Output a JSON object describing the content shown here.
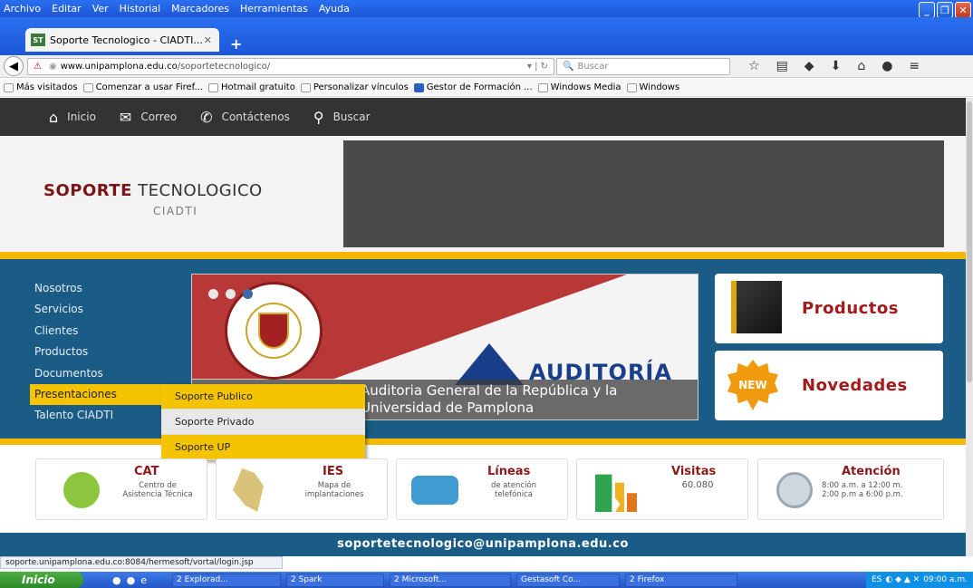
{
  "browser": {
    "menu": [
      "Archivo",
      "Editar",
      "Ver",
      "Historial",
      "Marcadores",
      "Herramientas",
      "Ayuda"
    ],
    "tab_title": "Soporte Tecnologico - CIADTI...",
    "tab_favicon": "ST",
    "url_host": "www.unipamplona.edu.co",
    "url_path": "/soportetecnologico/",
    "search_placeholder": "Buscar",
    "bookmarks": [
      "Más visitados",
      "Comenzar a usar Firef...",
      "Hotmail gratuito",
      "Personalizar vínculos",
      "Gestor de Formación ...",
      "Windows Media",
      "Windows"
    ],
    "status_url": "soporte.unipamplona.edu.co:8084/hermesoft/vortal/login.jsp"
  },
  "site": {
    "nav": [
      {
        "label": "Inicio",
        "icon": "home-icon"
      },
      {
        "label": "Correo",
        "icon": "mail-icon"
      },
      {
        "label": "Contáctenos",
        "icon": "phone-icon"
      },
      {
        "label": "Buscar",
        "icon": "search-icon"
      }
    ],
    "brand_bold": "SOPORTE",
    "brand_rest": " TECNOLOGICO",
    "brand_sub": "CIADTI",
    "side_menu": [
      "Nosotros",
      "Servicios",
      "Clientes",
      "Productos",
      "Documentos",
      "Presentaciones",
      "Talento CIADTI"
    ],
    "dropdown": [
      "Soporte Publico",
      "Soporte Privado",
      "Soporte UP"
    ],
    "slider": {
      "title": "AUDITORÍA",
      "caption_line1": "Auditoria General de la República y la",
      "caption_line2": "Universidad de Pamplona"
    },
    "promos": [
      "Productos",
      "Novedades"
    ],
    "promo_badge": "NEW",
    "cards": [
      {
        "title": "CAT",
        "sub": "Centro de\nAsistencia Técnica"
      },
      {
        "title": "IES",
        "sub": "Mapa de\nimplantaciones"
      },
      {
        "title": "Líneas",
        "sub": "de atención\ntelefónica"
      },
      {
        "title": "Visitas",
        "sub": "60.080"
      },
      {
        "title": "Atención",
        "sub": "8:00 a.m. a 12:00 m.\n2:00 p.m a 6:00 p.m."
      }
    ],
    "footer_email": "soportetecnologico@unipamplona.edu.co"
  },
  "taskbar": {
    "start": "Inicio",
    "items": [
      "2 Explorad...",
      "2 Spark",
      "2 Microsoft...",
      "Gestasoft Co...",
      "2 Firefox"
    ],
    "lang": "ES",
    "clock": "09:00 a.m."
  },
  "colors": {
    "accent_yellow": "#f5b800",
    "band_blue": "#1a5c86",
    "brand_red": "#7b1414"
  }
}
